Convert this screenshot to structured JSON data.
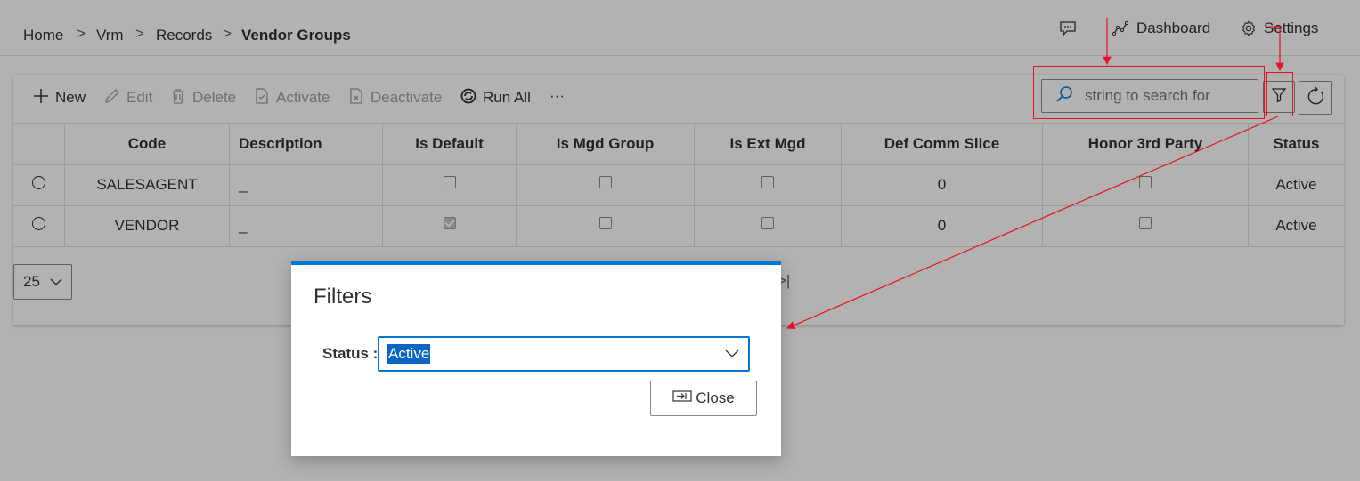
{
  "breadcrumb": {
    "items": [
      "Home",
      "Vrm",
      "Records",
      "Vendor Groups"
    ],
    "separator": ">"
  },
  "header": {
    "dashboard_label": "Dashboard",
    "settings_label": "Settings"
  },
  "toolbar": {
    "new_label": "New",
    "edit_label": "Edit",
    "delete_label": "Delete",
    "activate_label": "Activate",
    "deactivate_label": "Deactivate",
    "run_all_label": "Run All",
    "more_label": "···"
  },
  "search": {
    "placeholder": "string to search for",
    "value": ""
  },
  "table": {
    "headers": [
      "Code",
      "Description",
      "Is Default",
      "Is Mgd Group",
      "Is Ext Mgd",
      "Def Comm Slice",
      "Honor 3rd Party",
      "Status"
    ],
    "rows": [
      {
        "code": "SALESAGENT",
        "description": "_",
        "is_default": false,
        "is_mgd_group": false,
        "is_ext_mgd": false,
        "def_comm_slice": "0",
        "honor_3rd_party": false,
        "status": "Active"
      },
      {
        "code": "VENDOR",
        "description": "_",
        "is_default": true,
        "is_mgd_group": false,
        "is_ext_mgd": false,
        "def_comm_slice": "0",
        "honor_3rd_party": false,
        "status": "Active"
      }
    ]
  },
  "pager": {
    "page_size": "25",
    "last_page_glyph": ">|"
  },
  "dialog": {
    "title": "Filters",
    "status_label": "Status :",
    "status_value": "Active",
    "close_label": "Close"
  },
  "colors": {
    "accent": "#0078d4",
    "annotation": "#e81123"
  }
}
